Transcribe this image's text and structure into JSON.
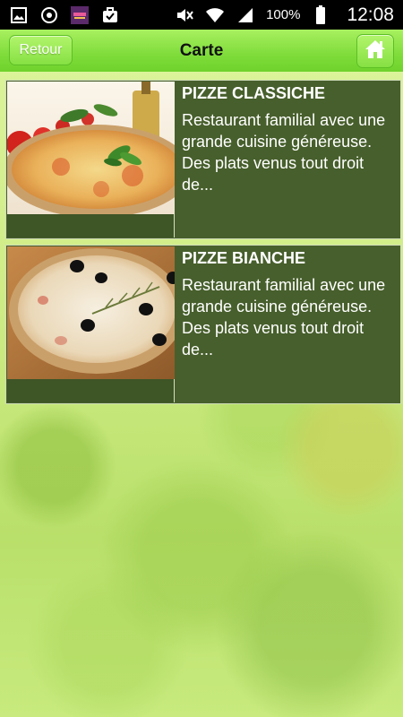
{
  "status_bar": {
    "time": "12:08",
    "battery_percent": "100%",
    "icons": [
      "gallery-icon",
      "sync-icon",
      "app-icon",
      "briefcase-check-icon",
      "mute-icon",
      "wifi-icon",
      "signal-icon",
      "battery-icon"
    ]
  },
  "header": {
    "back_label": "Retour",
    "title": "Carte",
    "home_icon": "home-icon"
  },
  "menu_items": [
    {
      "title": "PIZZE CLASSICHE",
      "description": "Restaurant familial avec une grande cuisine généreuse. Des plats venus tout droit de...",
      "image": "pizza-margherita"
    },
    {
      "title": "PIZZE BIANCHE",
      "description": "Restaurant familial avec une grande cuisine généreuse. Des plats venus tout droit de...",
      "image": "pizza-bianca-olives"
    }
  ],
  "colors": {
    "header_green": "#7fdc3a",
    "card_bg": "#475f2c",
    "page_bg": "#cfee8a"
  }
}
